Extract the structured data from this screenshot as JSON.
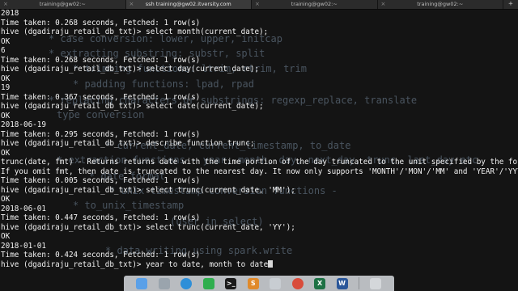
{
  "tabs": [
    {
      "label": "training@gw02:~",
      "active": false
    },
    {
      "label": "ssh training@gw02.itversity.com",
      "active": true
    },
    {
      "label": "training@gw02:~",
      "active": false
    },
    {
      "label": "training@gw02:~",
      "active": false
    }
  ],
  "new_tab_label": "+",
  "close_glyph": "×",
  "terminal_lines": [
    "2018",
    "Time taken: 0.268 seconds, Fetched: 1 row(s)",
    "hive (dgadiraju_retail_db_txt)> select month(current_date);",
    "OK",
    "6",
    "Time taken: 0.268 seconds, Fetched: 1 row(s)",
    "hive (dgadiraju_retail_db_txt)> select day(current_date);",
    "OK",
    "19",
    "Time taken: 0.367 seconds, Fetched: 1 row(s)",
    "hive (dgadiraju_retail_db_txt)> select date(current_date);",
    "OK",
    "2018-06-19",
    "Time taken: 0.295 seconds, Fetched: 1 row(s)",
    "hive (dgadiraju_retail_db_txt)> describe function trunc;",
    "OK",
    "trunc(date, fmt) - Returns returns date with the time portion of the day truncated to the unit specified by the format model fmt.",
    "If you omit fmt, then date is truncated to the nearest day. It now only supports 'MONTH'/'MON'/'MM' and 'YEAR'/'YYYY'/'YY' as format.",
    "Time taken: 0.005 seconds, Fetched: 1 row(s)",
    "hive (dgadiraju_retail_db_txt)> select trunc(current_date, 'MM');",
    "OK",
    "2018-06-01",
    "Time taken: 0.447 seconds, Fetched: 1 row(s)",
    "hive (dgadiraju_retail_db_txt)> select trunc(current_date, 'YY');",
    "OK",
    "2018-01-01",
    "Time taken: 0.424 seconds, Fetched: 1 row(s)"
  ],
  "current_command": "hive (dgadiraju_retail_db_txt)> year to date, month to date",
  "background_notes": [
    "* case conversion: lower, upper, initcap",
    "* extracting substring: substr, split",
    "* trimming functions: ltrim, rtrim, trim",
    "* padding functions: lpad, rpad",
    "* replacing characters or substrings: regexp_replace, translate",
    "type conversion",
    "* current_date, current_timestamp, to_date",
    "* extraction functions - year, month, day, next_day, trunc, last_day etc",
    "* date_format",
    "* unix timestamp conversion functions -",
    "* to_unix_timestamp",
    "(user in select)",
    "* data writing using spark.write"
  ],
  "dock": [
    {
      "name": "finder-icon",
      "color": "#5aa0e8",
      "glyph": ""
    },
    {
      "name": "launchpad-icon",
      "color": "#9aa4ad",
      "glyph": ""
    },
    {
      "name": "safari-icon",
      "color": "#2f8fd8",
      "glyph": ""
    },
    {
      "name": "facetime-icon",
      "color": "#2fae4e",
      "glyph": ""
    },
    {
      "name": "terminal-icon",
      "color": "#1a1a1a",
      "glyph": ">_"
    },
    {
      "name": "sublime-text-icon",
      "color": "#e08a2b",
      "glyph": "S"
    },
    {
      "name": "preview-icon",
      "color": "#c8cdd2",
      "glyph": ""
    },
    {
      "name": "chrome-icon",
      "color": "#d94c3b",
      "glyph": ""
    },
    {
      "name": "excel-icon",
      "color": "#1e7145",
      "glyph": "X"
    },
    {
      "name": "word-icon",
      "color": "#2b579a",
      "glyph": "W"
    },
    {
      "name": "trash-icon",
      "color": "#d4d7da",
      "glyph": ""
    }
  ]
}
